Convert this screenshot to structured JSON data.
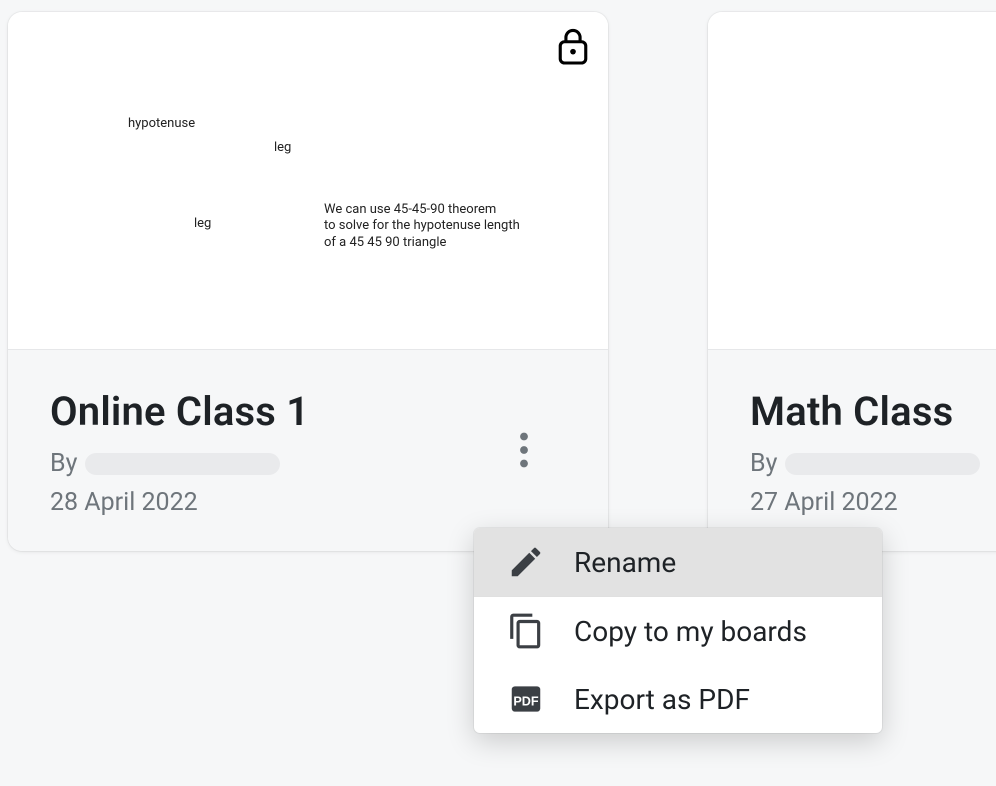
{
  "cards": [
    {
      "title": "Online Class 1",
      "by_label": "By",
      "date": "28 April 2022",
      "preview": {
        "label_hypotenuse": "hypotenuse",
        "label_leg1": "leg",
        "label_leg2": "leg",
        "note_line1": "We can use 45-45-90 theorem",
        "note_line2": "to solve for the hypotenuse length",
        "note_line3": "of a 45 45 90 triangle"
      },
      "locked": true
    },
    {
      "title": "Math Class",
      "by_label": "By",
      "date": "27 April 2022"
    }
  ],
  "menu": {
    "rename": "Rename",
    "copy": "Copy to my boards",
    "export": "Export as PDF"
  }
}
